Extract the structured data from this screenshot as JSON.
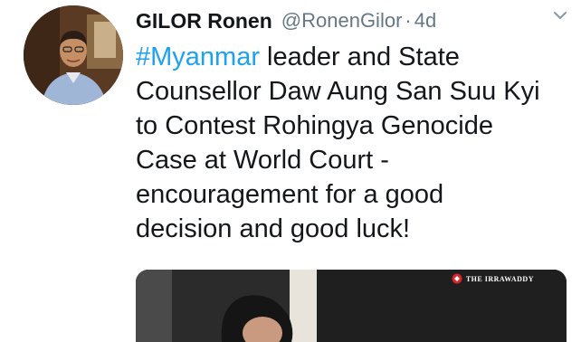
{
  "tweet": {
    "author_name": "GILOR Ronen",
    "handle": "@RonenGilor",
    "separator": "·",
    "timestamp": "4d",
    "text_lines": [
      {
        "hashtag": "#Myanmar",
        "rest": " leader and State"
      },
      {
        "hashtag": "",
        "rest": "Counsellor Daw Aung San Suu Kyi"
      },
      {
        "hashtag": "",
        "rest": "to Contest Rohingya Genocide"
      },
      {
        "hashtag": "",
        "rest": "Case at World Court -"
      },
      {
        "hashtag": "",
        "rest": "encouragement for a good"
      },
      {
        "hashtag": "",
        "rest": "decision and good luck!"
      }
    ],
    "media": {
      "watermark_text": "THE IRRAWADDY"
    }
  },
  "icons": {
    "menu": "chevron-down-icon",
    "watermark": "logo-icon"
  },
  "colors": {
    "hashtag": "#1da1f2",
    "secondary_text": "#657786",
    "primary_text": "#14171a"
  }
}
